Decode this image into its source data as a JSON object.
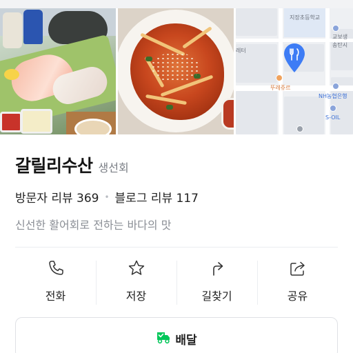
{
  "photos": {
    "map": {
      "labels": {
        "school": "지장초등학교",
        "corner": "레터",
        "bank_top": "교보생",
        "bank_bottom": "송탄시",
        "bakery": "뚜레쥬르",
        "nh_bank": "NH농협은행",
        "gas_station": "S-OIL"
      }
    }
  },
  "place": {
    "name": "갈릴리수산",
    "category": "생선회",
    "visitor_reviews": "방문자 리뷰 369",
    "separator": "•",
    "blog_reviews": "블로그 리뷰 117",
    "description": "신선한 활어회로 전하는 바다의 맛"
  },
  "actions": [
    {
      "label": "전화",
      "icon": "phone-icon"
    },
    {
      "label": "저장",
      "icon": "star-icon"
    },
    {
      "label": "길찾기",
      "icon": "directions-icon"
    },
    {
      "label": "공유",
      "icon": "share-icon"
    }
  ],
  "delivery": {
    "label": "배달",
    "icon": "delivery-truck-icon",
    "icon_color": "#03c75a"
  },
  "colors": {
    "map_pin": "#3d7cf5",
    "text_primary": "#141414",
    "text_secondary": "#8a8e95"
  }
}
